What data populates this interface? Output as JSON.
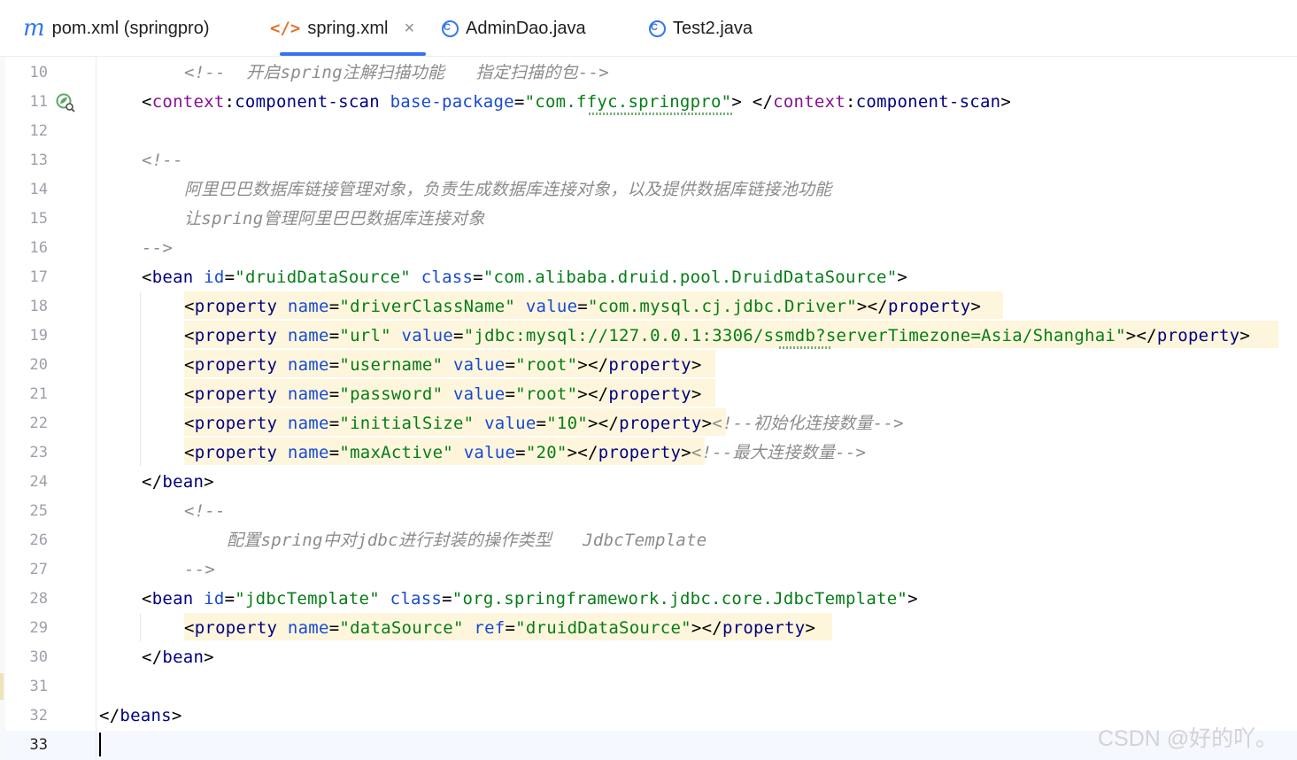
{
  "tabs": [
    {
      "label": "pom.xml (springpro)",
      "icon": "maven-icon",
      "icon_glyph": "m"
    },
    {
      "label": "spring.xml",
      "icon": "xml-file-icon",
      "icon_glyph": "</>",
      "active": true,
      "close": "×"
    },
    {
      "label": "AdminDao.java",
      "icon": "java-class-icon",
      "icon_glyph": "C"
    },
    {
      "label": "Test2.java",
      "icon": "java-class-icon",
      "icon_glyph": "C"
    }
  ],
  "gutter": {
    "line_numbers": [
      "10",
      "11",
      "12",
      "13",
      "14",
      "15",
      "16",
      "17",
      "18",
      "19",
      "20",
      "21",
      "22",
      "23",
      "24",
      "25",
      "26",
      "27",
      "28",
      "29",
      "30",
      "31",
      "32",
      "33"
    ],
    "bean_icon_line": "11"
  },
  "code": {
    "l10": {
      "comment": "<!--  开启spring注解扫描功能   指定扫描的包-->"
    },
    "l11": {
      "tag_open": "<",
      "ns": "context",
      "colon": ":",
      "tag": "component-scan",
      "attr": "base-package",
      "eq": "=",
      "value": "\"com.ffyc.springpro\"",
      "close": ">",
      "end_open": "</",
      "end_ns": "context",
      "end_colon": ":",
      "end_tag": "component-scan",
      "end_close": ">"
    },
    "l13": {
      "comment": "<!--"
    },
    "l14": {
      "comment": "阿里巴巴数据库链接管理对象，负责生成数据库连接对象，以及提供数据库链接池功能"
    },
    "l15": {
      "comment": "让spring管理阿里巴巴数据库连接对象"
    },
    "l16": {
      "comment": "-->"
    },
    "l17": {
      "tag": "bean",
      "attr1": "id",
      "val1": "\"druidDataSource\"",
      "attr2": "class",
      "val2": "\"com.alibaba.druid.pool.DruidDataSource\""
    },
    "l18": {
      "tag": "property",
      "attr1": "name",
      "val1": "\"driverClassName\"",
      "attr2": "value",
      "val2": "\"com.mysql.cj.jdbc.Driver\"",
      "end_tag": "property"
    },
    "l19": {
      "tag": "property",
      "attr1": "name",
      "val1": "\"url\"",
      "attr2": "value",
      "val2": "\"jdbc:mysql://127.0.0.1:3306/ssmdb?serverTimezone=Asia/Shanghai\"",
      "end_tag": "property"
    },
    "l20": {
      "tag": "property",
      "attr1": "name",
      "val1": "\"username\"",
      "attr2": "value",
      "val2": "\"root\"",
      "end_tag": "property"
    },
    "l21": {
      "tag": "property",
      "attr1": "name",
      "val1": "\"password\"",
      "attr2": "value",
      "val2": "\"root\"",
      "end_tag": "property"
    },
    "l22": {
      "tag": "property",
      "attr1": "name",
      "val1": "\"initialSize\"",
      "attr2": "value",
      "val2": "\"10\"",
      "end_tag": "property",
      "comment": "<!--初始化连接数量-->"
    },
    "l23": {
      "tag": "property",
      "attr1": "name",
      "val1": "\"maxActive\"",
      "attr2": "value",
      "val2": "\"20\"",
      "end_tag": "property",
      "comment": "<!--最大连接数量-->"
    },
    "l24": {
      "end_tag": "bean"
    },
    "l25": {
      "comment": "<!--"
    },
    "l26": {
      "comment": "配置spring中对jdbc进行封装的操作类型   JdbcTemplate"
    },
    "l27": {
      "comment": "-->"
    },
    "l28": {
      "tag": "bean",
      "attr1": "id",
      "val1": "\"jdbcTemplate\"",
      "attr2": "class",
      "val2": "\"org.springframework.jdbc.core.JdbcTemplate\""
    },
    "l29": {
      "tag": "property",
      "attr1": "name",
      "val1": "\"dataSource\"",
      "attr2": "ref",
      "val2": "\"druidDataSource\"",
      "end_tag": "property"
    },
    "l30": {
      "end_tag": "bean"
    },
    "l32": {
      "end_tag": "beans"
    }
  },
  "syntax": {
    "tag": "#000080",
    "attr": "#174ad4",
    "value": "#067d17",
    "comment": "#8c8c8c",
    "namespace": "#871094",
    "highlight": "#fdf6dc",
    "accent": "#3574f0"
  },
  "watermark": "CSDN @好的吖。"
}
